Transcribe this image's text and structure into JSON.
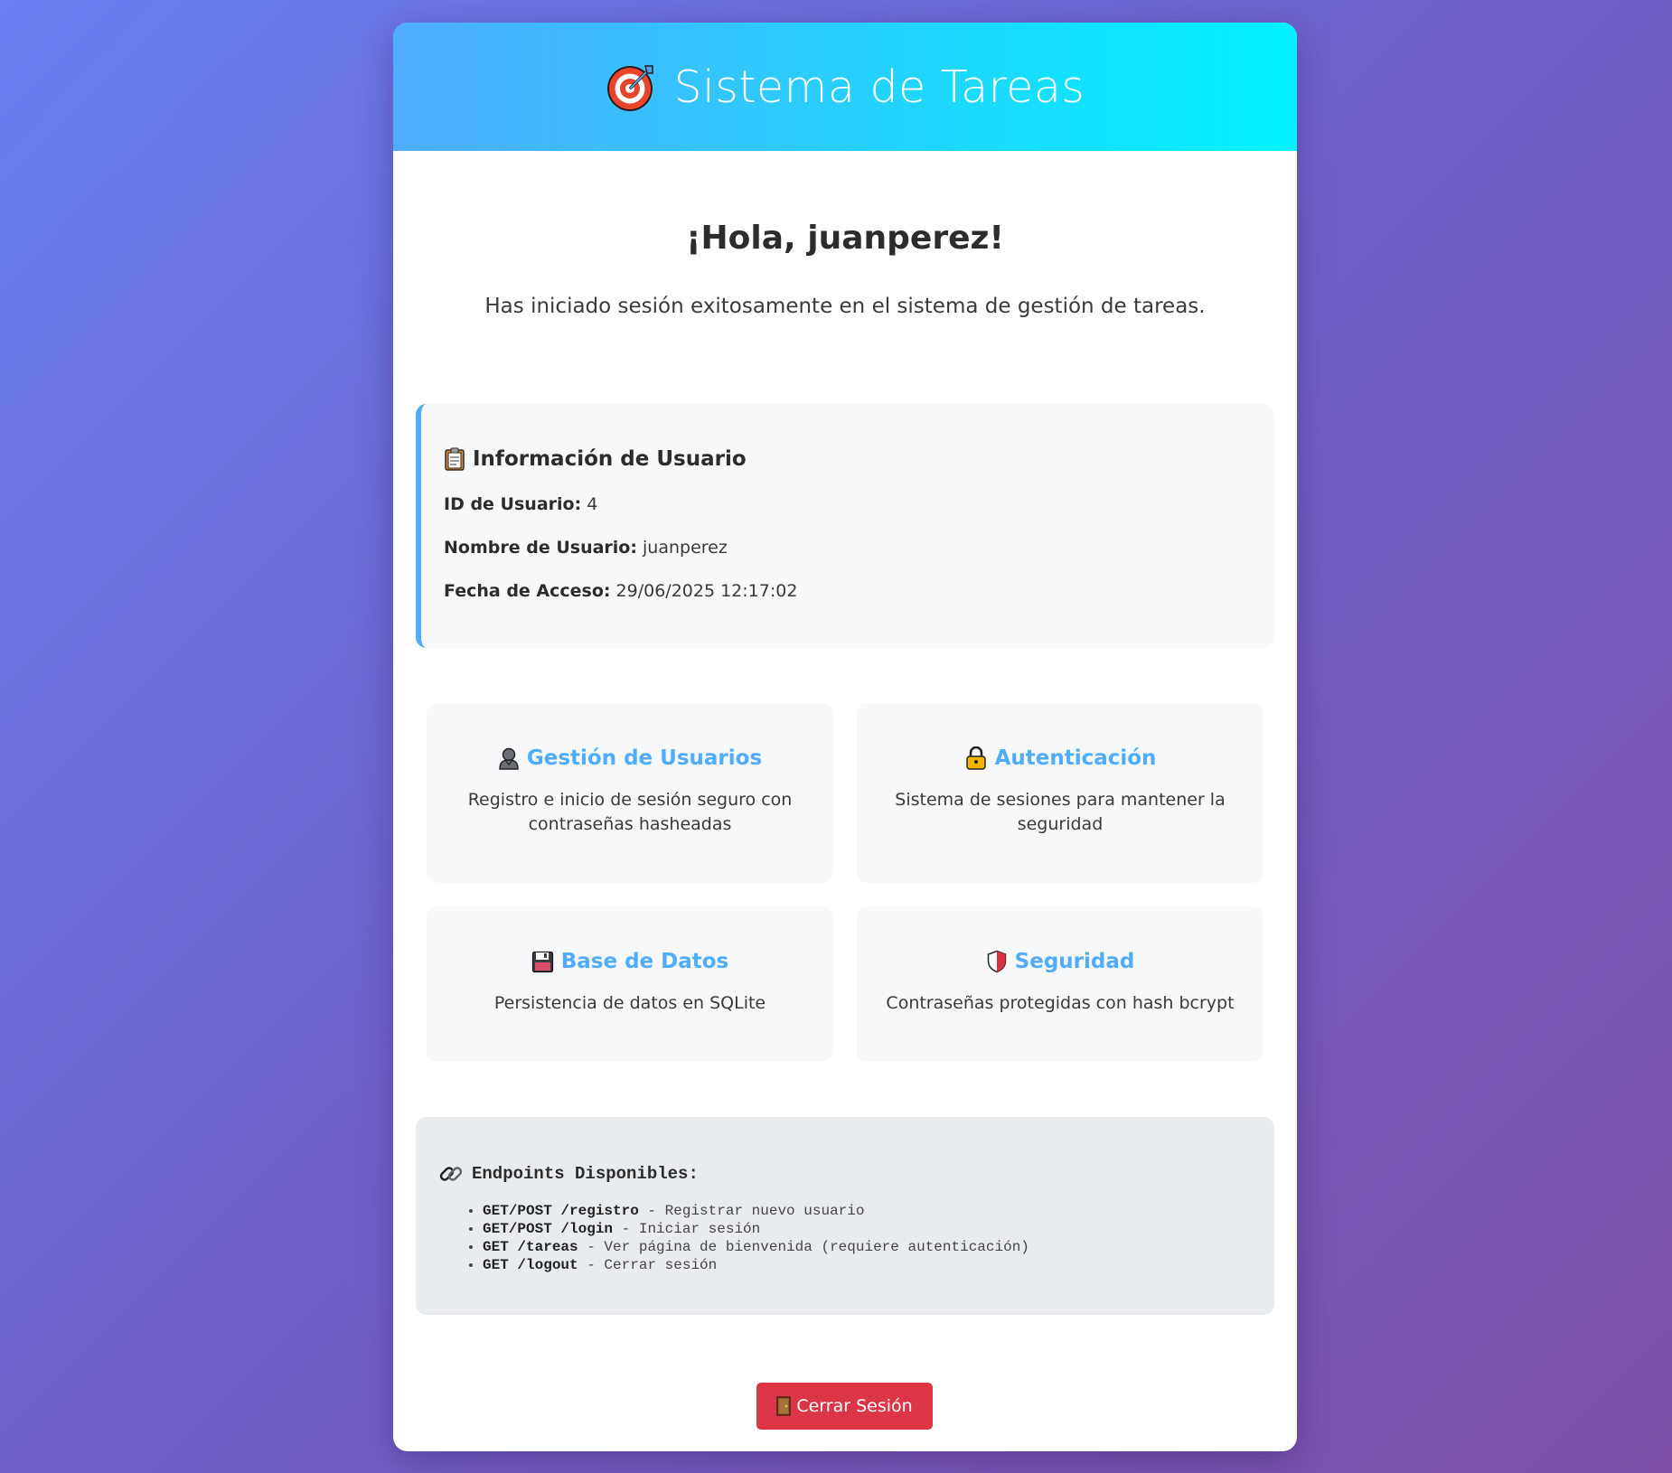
{
  "header": {
    "title": "Sistema de Tareas",
    "icon": "target-icon"
  },
  "welcome": {
    "greeting": "¡Hola, juanperez!",
    "subtitle": "Has iniciado sesión exitosamente en el sistema de gestión de tareas."
  },
  "user_info": {
    "title": "Información de Usuario",
    "icon": "clipboard-icon",
    "rows": [
      {
        "label": "ID de Usuario:",
        "value": "4"
      },
      {
        "label": "Nombre de Usuario:",
        "value": "juanperez"
      },
      {
        "label": "Fecha de Acceso:",
        "value": "29/06/2025 12:17:02"
      }
    ]
  },
  "features": [
    {
      "icon": "user-icon",
      "title": "Gestión de Usuarios",
      "desc": "Registro e inicio de sesión seguro con contraseñas hasheadas"
    },
    {
      "icon": "lock-icon",
      "title": "Autenticación",
      "desc": "Sistema de sesiones para mantener la seguridad"
    },
    {
      "icon": "floppy-disk-icon",
      "title": "Base de Datos",
      "desc": "Persistencia de datos en SQLite"
    },
    {
      "icon": "shield-icon",
      "title": "Seguridad",
      "desc": "Contraseñas protegidas con hash bcrypt"
    }
  ],
  "endpoints": {
    "title": "Endpoints Disponibles:",
    "icon": "link-icon",
    "items": [
      {
        "method": "GET/POST /registro",
        "desc": " - Registrar nuevo usuario"
      },
      {
        "method": "GET/POST /login",
        "desc": " - Iniciar sesión"
      },
      {
        "method": "GET /tareas",
        "desc": " - Ver página de bienvenida (requiere autenticación)"
      },
      {
        "method": "GET /logout",
        "desc": " - Cerrar sesión"
      }
    ]
  },
  "logout": {
    "label": "Cerrar Sesión",
    "icon": "door-icon"
  },
  "colors": {
    "accent": "#4facfe",
    "header_gradient_end": "#00f2fe",
    "danger": "#dc3545"
  }
}
